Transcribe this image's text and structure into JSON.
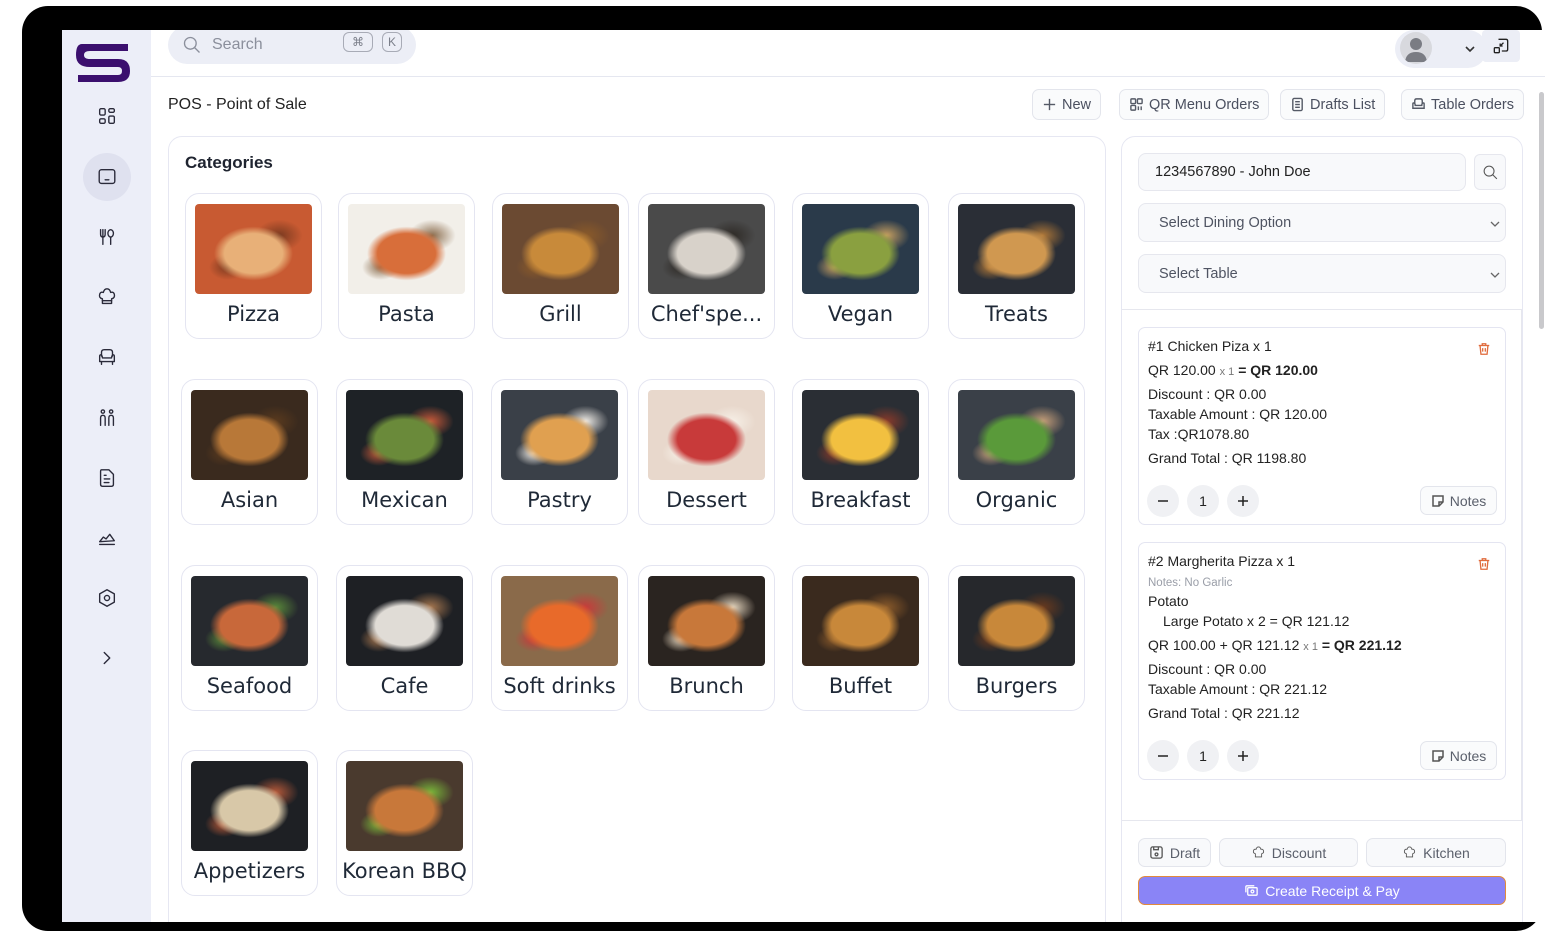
{
  "app": {
    "brand_color": "#3b0f6e",
    "accent_color": "#8a84f6"
  },
  "topbar": {
    "search_placeholder": "Search",
    "shortcut_keys": [
      "⌘",
      "K"
    ],
    "avatar_icon": "user-avatar-icon",
    "user_menu_icon": "chevron-down-icon",
    "collapse_icon": "minimize-window-icon"
  },
  "sidebar": {
    "items": [
      {
        "name": "dashboard",
        "icon": "grid-icon"
      },
      {
        "name": "pos",
        "icon": "tablet-icon",
        "active": true
      },
      {
        "name": "menu",
        "icon": "fork-spoon-icon"
      },
      {
        "name": "kitchen",
        "icon": "chef-hat-icon"
      },
      {
        "name": "tables",
        "icon": "armchair-icon"
      },
      {
        "name": "staff",
        "icon": "people-icon"
      },
      {
        "name": "reports",
        "icon": "document-icon"
      },
      {
        "name": "analytics",
        "icon": "chart-area-icon"
      },
      {
        "name": "settings",
        "icon": "hex-settings-icon"
      },
      {
        "name": "expand",
        "icon": "chevron-right-icon"
      }
    ]
  },
  "header": {
    "title": "POS - Point of Sale",
    "buttons": {
      "new": "New",
      "qr_menu_orders": "QR Menu Orders",
      "drafts_list": "Drafts List",
      "table_orders": "Table Orders"
    }
  },
  "categories": {
    "title": "Categories",
    "items": [
      {
        "label": "Pizza",
        "colors": [
          "#c85a32",
          "#e8b078",
          "#7a3a20"
        ]
      },
      {
        "label": "Pasta",
        "colors": [
          "#f2efe9",
          "#d86e3a",
          "#8b6d4e"
        ]
      },
      {
        "label": "Grill",
        "colors": [
          "#6b4a32",
          "#c88a3a",
          "#8a5a2a"
        ]
      },
      {
        "label": "Chef'spe...",
        "colors": [
          "#4a4a4a",
          "#d8d2ca",
          "#2e2a26"
        ]
      },
      {
        "label": "Vegan",
        "colors": [
          "#2a3a4a",
          "#8aa040",
          "#c8a060"
        ]
      },
      {
        "label": "Treats",
        "colors": [
          "#2a2e36",
          "#d09850",
          "#b07838"
        ]
      },
      {
        "label": "Asian",
        "colors": [
          "#3a2a1e",
          "#b87838",
          "#5a3a1e"
        ]
      },
      {
        "label": "Mexican",
        "colors": [
          "#1e2226",
          "#6a8a3a",
          "#c85a3a"
        ]
      },
      {
        "label": "Pastry",
        "colors": [
          "#3a4048",
          "#e0a050",
          "#f2eee8"
        ]
      },
      {
        "label": "Dessert",
        "colors": [
          "#e8d8cc",
          "#c83a3a",
          "#f6efe6"
        ]
      },
      {
        "label": "Breakfast",
        "colors": [
          "#2a2e34",
          "#f2c040",
          "#8a3a2a"
        ]
      },
      {
        "label": "Organic",
        "colors": [
          "#3a4048",
          "#5a9a3a",
          "#c8a07a"
        ]
      },
      {
        "label": "Seafood",
        "colors": [
          "#26292e",
          "#c8683a",
          "#5a8a3a"
        ]
      },
      {
        "label": "Cafe",
        "colors": [
          "#1e2024",
          "#e0dcd6",
          "#a87850"
        ]
      },
      {
        "label": "Soft drinks",
        "colors": [
          "#8a6a4a",
          "#e86a2a",
          "#c83a3a"
        ]
      },
      {
        "label": "Brunch",
        "colors": [
          "#2a2420",
          "#c8783a",
          "#e8d8c0"
        ]
      },
      {
        "label": "Buffet",
        "colors": [
          "#3a2a1e",
          "#c8883a",
          "#8a5a2a"
        ]
      },
      {
        "label": "Burgers",
        "colors": [
          "#26282c",
          "#c8883a",
          "#6a3a1e"
        ]
      },
      {
        "label": "Appetizers",
        "colors": [
          "#1e2024",
          "#d8c8a8",
          "#b85a3a"
        ]
      },
      {
        "label": "Korean BBQ",
        "colors": [
          "#4a3a2e",
          "#c8783a",
          "#7ab83a"
        ]
      }
    ]
  },
  "order": {
    "customer_value": "1234567890 - John Doe",
    "dining_placeholder": "Select Dining Option",
    "table_placeholder": "Select Table",
    "items": [
      {
        "title": "#1 Chicken Piza x 1",
        "price_line": "QR 120.00",
        "multiplier": "x 1",
        "total": "= QR 120.00",
        "discount": "Discount : QR 0.00",
        "taxable": "Taxable Amount : QR 120.00",
        "tax": "Tax :QR1078.80",
        "grand_total": "Grand Total : QR 1198.80",
        "qty": "1",
        "notes_label": "Notes"
      },
      {
        "title": "#2 Margherita Pizza x 1",
        "note": "Notes: No Garlic",
        "addon_group": "Potato",
        "addon_line": "Large Potato x 2 = QR 121.12",
        "price_line": "QR 100.00 + QR 121.12",
        "multiplier": "x 1",
        "total": "= QR 221.12",
        "discount": "Discount : QR 0.00",
        "taxable": "Taxable Amount : QR 221.12",
        "grand_total": "Grand Total : QR 221.12",
        "qty": "1",
        "notes_label": "Notes"
      }
    ],
    "actions": {
      "draft": "Draft",
      "discount": "Discount",
      "kitchen": "Kitchen",
      "pay": "Create Receipt & Pay"
    }
  }
}
